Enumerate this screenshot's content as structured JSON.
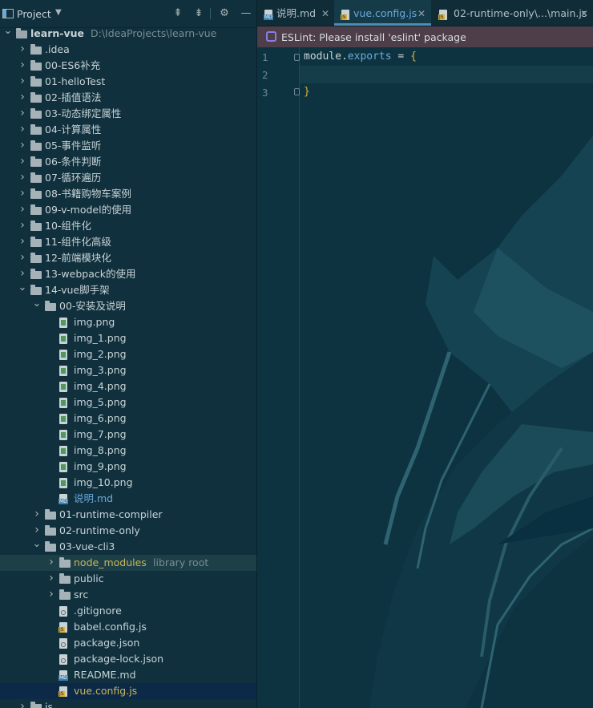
{
  "panel": {
    "title": "Project",
    "tree": [
      {
        "label": "learn-vue",
        "extra": "D:\\IdeaProjects\\learn-vue",
        "type": "folder",
        "depth": 0,
        "expanded": true,
        "root": true
      },
      {
        "label": ".idea",
        "type": "folder",
        "depth": 1,
        "expanded": false
      },
      {
        "label": "00-ES6补充",
        "type": "folder",
        "depth": 1,
        "expanded": false
      },
      {
        "label": "01-helloTest",
        "type": "folder",
        "depth": 1,
        "expanded": false
      },
      {
        "label": "02-插值语法",
        "type": "folder",
        "depth": 1,
        "expanded": false
      },
      {
        "label": "03-动态绑定属性",
        "type": "folder",
        "depth": 1,
        "expanded": false
      },
      {
        "label": "04-计算属性",
        "type": "folder",
        "depth": 1,
        "expanded": false
      },
      {
        "label": "05-事件监听",
        "type": "folder",
        "depth": 1,
        "expanded": false
      },
      {
        "label": "06-条件判断",
        "type": "folder",
        "depth": 1,
        "expanded": false
      },
      {
        "label": "07-循环遍历",
        "type": "folder",
        "depth": 1,
        "expanded": false
      },
      {
        "label": "08-书籍购物车案例",
        "type": "folder",
        "depth": 1,
        "expanded": false
      },
      {
        "label": "09-v-model的使用",
        "type": "folder",
        "depth": 1,
        "expanded": false
      },
      {
        "label": "10-组件化",
        "type": "folder",
        "depth": 1,
        "expanded": false
      },
      {
        "label": "11-组件化高级",
        "type": "folder",
        "depth": 1,
        "expanded": false
      },
      {
        "label": "12-前端模块化",
        "type": "folder",
        "depth": 1,
        "expanded": false
      },
      {
        "label": "13-webpack的使用",
        "type": "folder",
        "depth": 1,
        "expanded": false
      },
      {
        "label": "14-vue脚手架",
        "type": "folder",
        "depth": 1,
        "expanded": true
      },
      {
        "label": "00-安装及说明",
        "type": "folder",
        "depth": 2,
        "expanded": true
      },
      {
        "label": "img.png",
        "type": "img",
        "depth": 3
      },
      {
        "label": "img_1.png",
        "type": "img",
        "depth": 3
      },
      {
        "label": "img_2.png",
        "type": "img",
        "depth": 3
      },
      {
        "label": "img_3.png",
        "type": "img",
        "depth": 3
      },
      {
        "label": "img_4.png",
        "type": "img",
        "depth": 3
      },
      {
        "label": "img_5.png",
        "type": "img",
        "depth": 3
      },
      {
        "label": "img_6.png",
        "type": "img",
        "depth": 3
      },
      {
        "label": "img_7.png",
        "type": "img",
        "depth": 3
      },
      {
        "label": "img_8.png",
        "type": "img",
        "depth": 3
      },
      {
        "label": "img_9.png",
        "type": "img",
        "depth": 3
      },
      {
        "label": "img_10.png",
        "type": "img",
        "depth": 3
      },
      {
        "label": "说明.md",
        "type": "md",
        "depth": 3,
        "color": "blue"
      },
      {
        "label": "01-runtime-compiler",
        "type": "folder",
        "depth": 2,
        "expanded": false
      },
      {
        "label": "02-runtime-only",
        "type": "folder",
        "depth": 2,
        "expanded": false
      },
      {
        "label": "03-vue-cli3",
        "type": "folder",
        "depth": 2,
        "expanded": true
      },
      {
        "label": "node_modules",
        "extra": "library root",
        "type": "folder",
        "depth": 3,
        "expanded": false,
        "color": "yellow",
        "highlight": true
      },
      {
        "label": "public",
        "type": "folder",
        "depth": 3,
        "expanded": false
      },
      {
        "label": "src",
        "type": "folder",
        "depth": 3,
        "expanded": false
      },
      {
        "label": ".gitignore",
        "type": "cfg",
        "depth": 3
      },
      {
        "label": "babel.config.js",
        "type": "js",
        "depth": 3
      },
      {
        "label": "package.json",
        "type": "cfg",
        "depth": 3
      },
      {
        "label": "package-lock.json",
        "type": "cfg",
        "depth": 3
      },
      {
        "label": "README.md",
        "type": "md",
        "depth": 3
      },
      {
        "label": "vue.config.js",
        "type": "js",
        "depth": 3,
        "color": "yellow",
        "selected": true
      },
      {
        "label": "js",
        "type": "folder",
        "depth": 1,
        "expanded": false
      }
    ]
  },
  "tabs": [
    {
      "label": "说明.md",
      "icon": "md"
    },
    {
      "label": "vue.config.js",
      "icon": "js",
      "active": true
    },
    {
      "label": "02-runtime-only\\...\\main.js",
      "icon": "js"
    }
  ],
  "banner": {
    "text": "ESLint: Please install 'eslint' package"
  },
  "editor": {
    "line_numbers": [
      "1",
      "2",
      "3"
    ],
    "line1_plain": "module.",
    "line1_prop": "exports",
    "line1_op": " = ",
    "line1_brace": "{",
    "line3_brace": "}"
  }
}
